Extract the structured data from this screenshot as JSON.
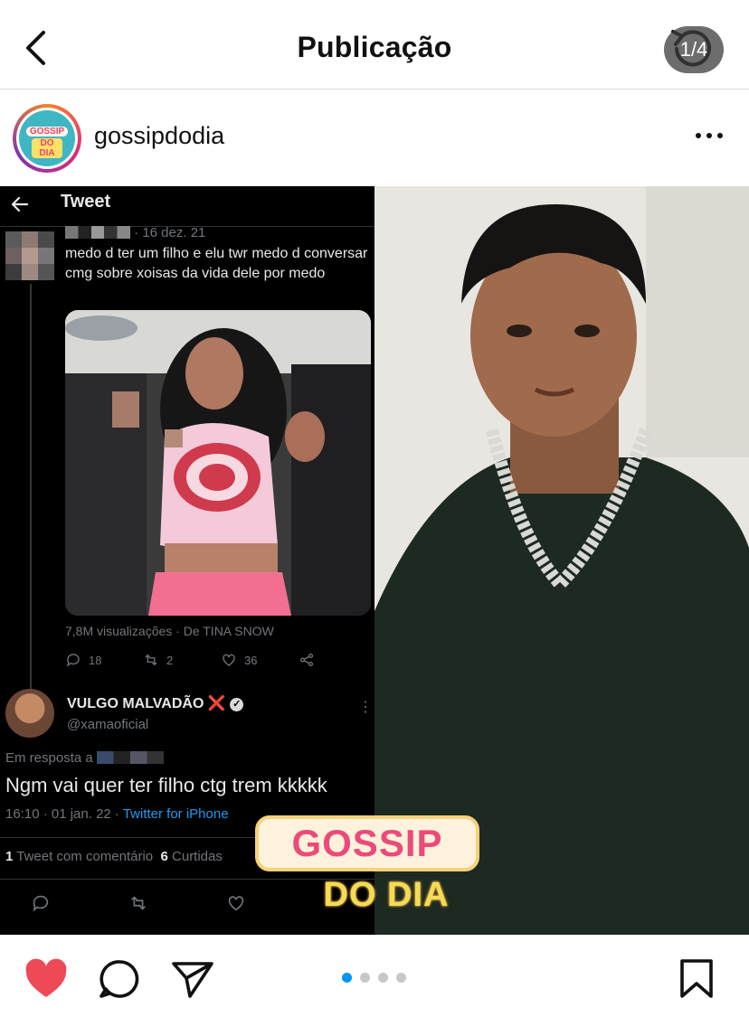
{
  "topbar": {
    "title": "Publicação"
  },
  "post": {
    "username": "gossipdodia",
    "avatar_logo": [
      "GOSSIP",
      "DO DIA"
    ],
    "counter": "1/4",
    "carousel": {
      "active_index": 0,
      "count": 4
    }
  },
  "tweet": {
    "header_title": "Tweet",
    "reply": {
      "date": "· 16 dez. 21",
      "text": "medo d ter um filho e elu twr medo d conversar cmg sobre xoisas da vida dele por medo",
      "video_stats": "7,8M visualizações · De TINA SNOW",
      "replies": "18",
      "retweets": "2",
      "likes": "36"
    },
    "main": {
      "name": "VULGO MALVADÃO",
      "name_emoji": "❌",
      "handle": "@xamaoficial",
      "reply_to": "Em resposta a",
      "text": "Ngm vai quer ter filho ctg trem kkkkk",
      "time": "16:10 · 01 jan. 22 ·",
      "source": "Twitter for iPhone",
      "quote_count": "1",
      "quote_label": "Tweet com comentário",
      "retweet_count": "6",
      "retweet_label": "Curtidas"
    }
  },
  "watermark": {
    "line1": "GOSSIP",
    "line2": "DO DIA"
  },
  "colors": {
    "like_red": "#ed4956",
    "active_dot": "#0095f6",
    "twitter_blue": "#1d9bf0"
  }
}
